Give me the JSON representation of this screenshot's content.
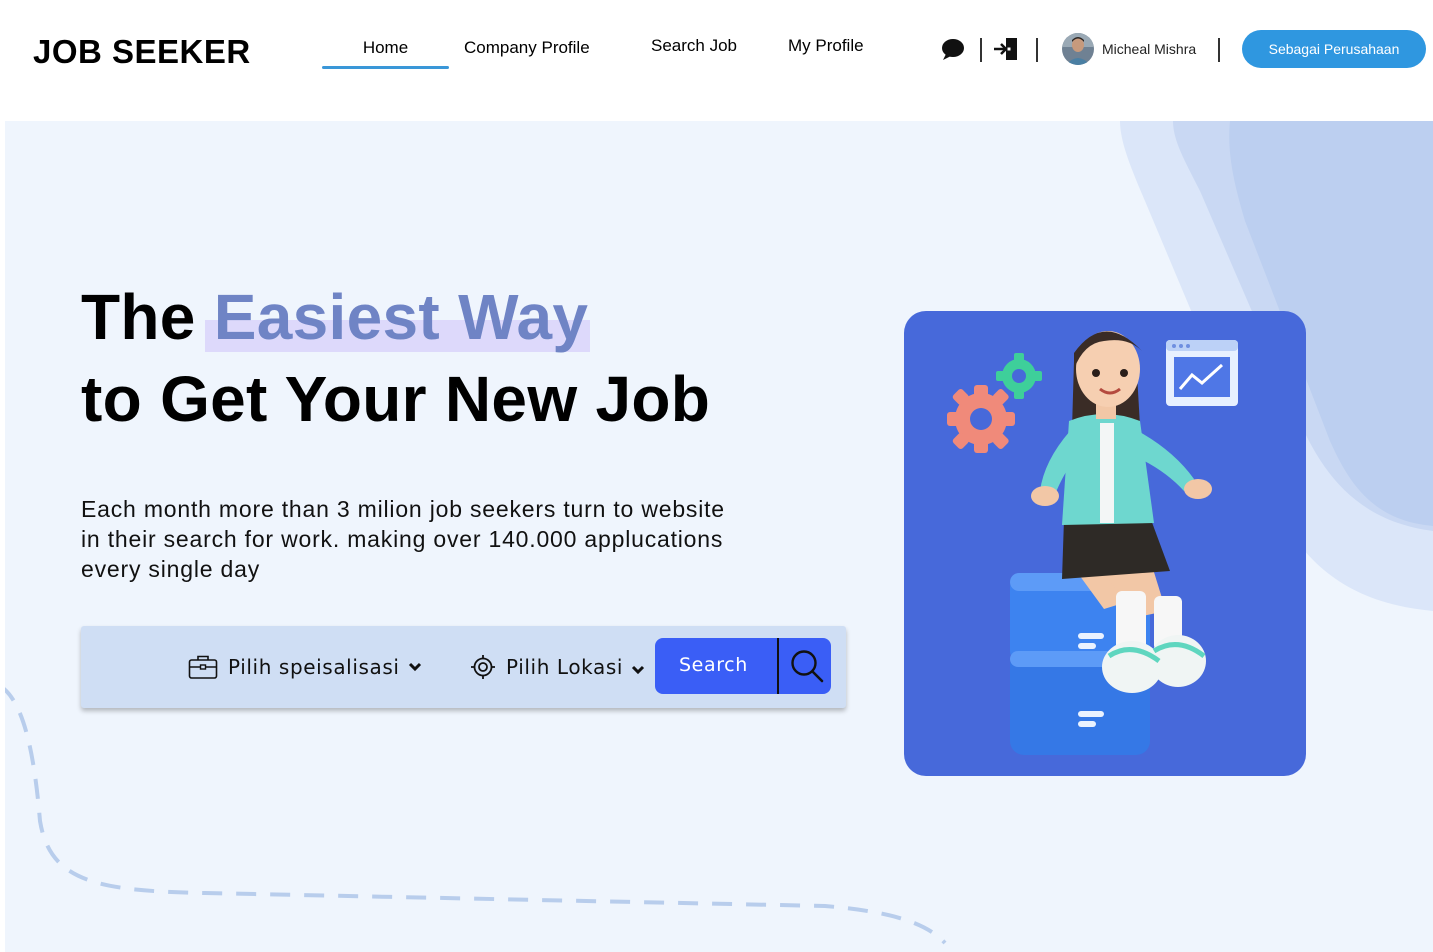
{
  "header": {
    "logo": "JOB SEEKER",
    "nav": {
      "home": "Home",
      "company_profile": "Company Profile",
      "search_job": "Search Job",
      "my_profile": "My Profile"
    },
    "active_nav": "Home",
    "user_name": "Micheal Mishra",
    "cta_label": "Sebagai Perusahaan"
  },
  "hero": {
    "headline_part1": "The",
    "headline_highlight": "Easiest Way",
    "headline_line2": "to Get Your New Job",
    "subtext": "Each month more than 3 milion job seekers turn to website in their search for work. making over 140.000 applucations every single day"
  },
  "search": {
    "specialization_label": "Pilih speisalisasi",
    "location_label": "Pilih Lokasi",
    "button_label": "Search"
  },
  "icons": {
    "chat": "chat-bubble-icon",
    "logout": "logout-icon",
    "briefcase": "briefcase-icon",
    "location": "target-icon",
    "search": "magnifier-icon"
  },
  "colors": {
    "accent": "#2f97e0",
    "highlight_text": "#6f84c5",
    "search_button": "#3a5ef6",
    "hero_bg": "#eff5fd",
    "illustration_bg": "#4769da"
  }
}
